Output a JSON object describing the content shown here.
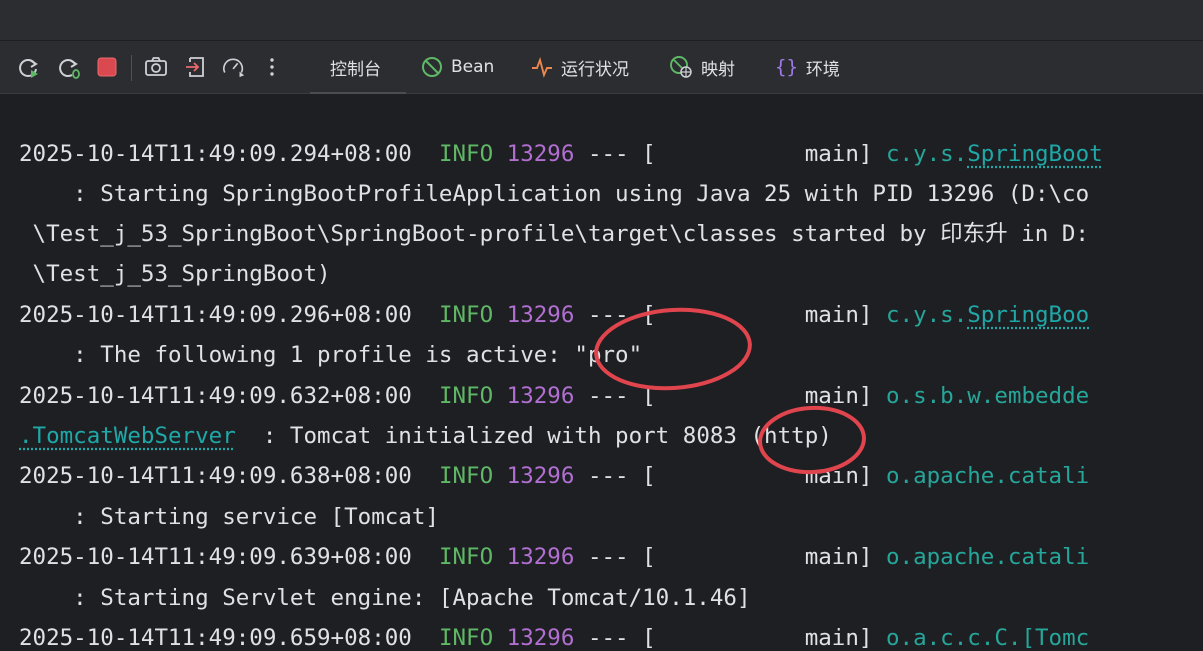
{
  "toolbar": {
    "icons": [
      "rerun-icon",
      "rerun-debug-icon",
      "stop-icon",
      "screenshot-icon",
      "exit-icon",
      "dashboard-icon",
      "more-vertical-icon"
    ],
    "tabs": [
      {
        "label": "控制台",
        "icon": "none",
        "active": true
      },
      {
        "label": "Bean",
        "icon": "bean-icon",
        "active": false
      },
      {
        "label": "运行状况",
        "icon": "health-pulse-icon",
        "active": false
      },
      {
        "label": "映射",
        "icon": "mapping-globe-icon",
        "active": false
      },
      {
        "label": "环境",
        "icon": "braces-icon",
        "active": false
      }
    ]
  },
  "console": {
    "lines": [
      {
        "timestamp": "2025-10-14T11:49:09.294+08:00",
        "level": "INFO",
        "pid": "13296",
        "sep": "---",
        "thread": "[           main]",
        "logger_prefix": "c.y.s.",
        "logger_link": "SpringBoot"
      },
      {
        "text": "    : Starting SpringBootProfileApplication using Java 25 with PID 13296 (D:\\co"
      },
      {
        "text": " \\Test_j_53_SpringBoot\\SpringBoot-profile\\target\\classes started by 印东升 in D:"
      },
      {
        "text": " \\Test_j_53_SpringBoot)"
      },
      {
        "timestamp": "2025-10-14T11:49:09.296+08:00",
        "level": "INFO",
        "pid": "13296",
        "sep": "---",
        "thread": "[           main]",
        "logger_prefix": "c.y.s.",
        "logger_link": "SpringBoo"
      },
      {
        "text": "    : The following 1 profile is active: \"pro\""
      },
      {
        "timestamp": "2025-10-14T11:49:09.632+08:00",
        "level": "INFO",
        "pid": "13296",
        "sep": "---",
        "thread": "[           main]",
        "logger_prefix": "o.s.b.w.embedde",
        "logger_link": ""
      },
      {
        "class_link": ".TomcatWebServer",
        "text": "  : Tomcat initialized with port 8083 (http)"
      },
      {
        "timestamp": "2025-10-14T11:49:09.638+08:00",
        "level": "INFO",
        "pid": "13296",
        "sep": "---",
        "thread": "[           main]",
        "logger_prefix": "o.apache.catali",
        "logger_link": ""
      },
      {
        "text": "    : Starting service [Tomcat]"
      },
      {
        "timestamp": "2025-10-14T11:49:09.639+08:00",
        "level": "INFO",
        "pid": "13296",
        "sep": "---",
        "thread": "[           main]",
        "logger_prefix": "o.apache.catali",
        "logger_link": ""
      },
      {
        "text": "    : Starting Servlet engine: [Apache Tomcat/10.1.46]"
      },
      {
        "timestamp": "2025-10-14T11:49:09.659+08:00",
        "level": "INFO",
        "pid": "13296",
        "sep": "---",
        "thread": "[           main]",
        "logger_prefix": "o.a.c.c.C.[Tomc",
        "logger_link": ""
      }
    ]
  },
  "annotations": {
    "color": "#e0454e",
    "circled": [
      "\"pro\"",
      "8083"
    ]
  },
  "colors": {
    "info": "#5fb865",
    "pid": "#b16fd1",
    "logger": "#1fa8a8",
    "text": "#dfe1e5",
    "background": "#1e1f22"
  }
}
